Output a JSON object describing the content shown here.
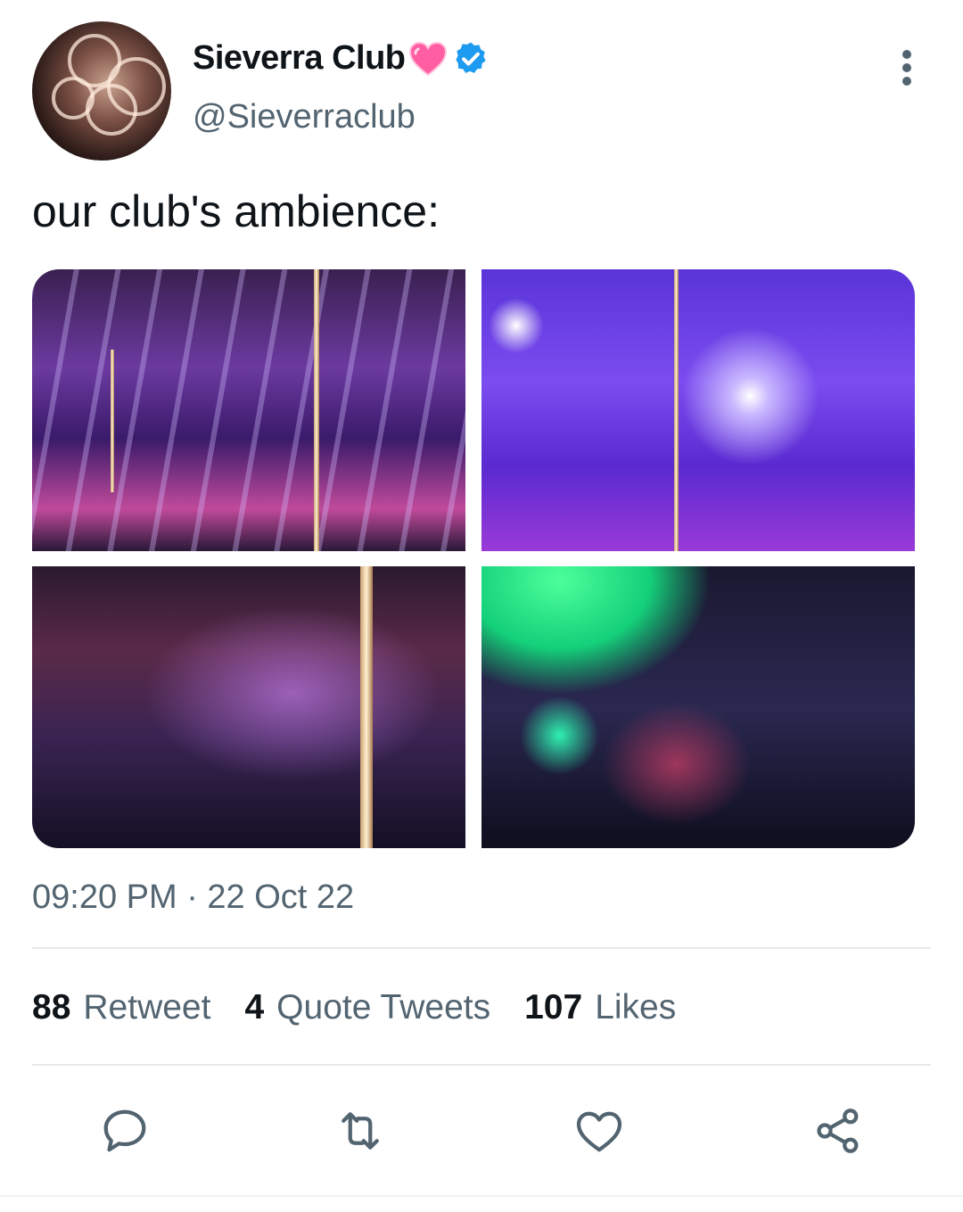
{
  "tweet": {
    "display_name": "Sieverra Club",
    "handle": "@Sieverraclub",
    "text": "our club's ambience:",
    "timestamp": "09:20 PM · 22 Oct 22",
    "stats": [
      {
        "count": "88",
        "label": "Retweet"
      },
      {
        "count": "4",
        "label": "Quote Tweets"
      },
      {
        "count": "107",
        "label": "Likes"
      }
    ],
    "icons": {
      "name_emoji": "sparkling-heart-icon",
      "badge": "verified-badge-icon",
      "more": "more-options-icon",
      "reply": "reply-icon",
      "retweet": "retweet-icon",
      "like": "like-icon",
      "share": "share-icon"
    },
    "colors": {
      "verified": "#1d9bf0",
      "heart": "#ff5fa2",
      "secondary_text": "#536471"
    }
  }
}
